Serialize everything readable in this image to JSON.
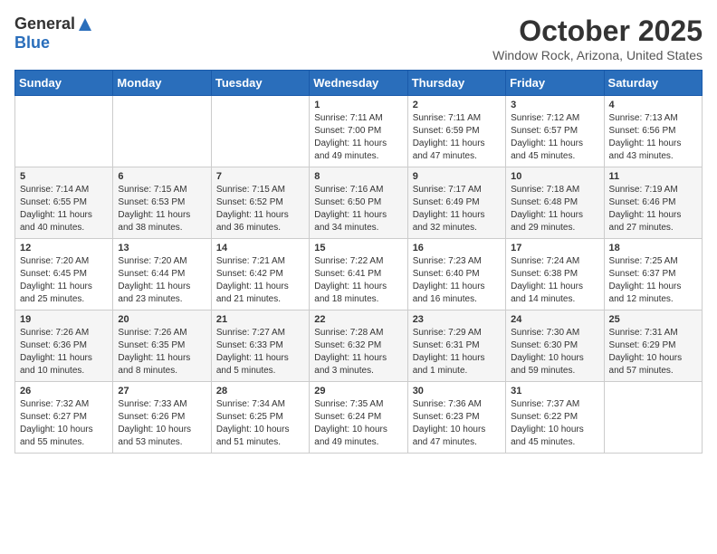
{
  "header": {
    "logo_general": "General",
    "logo_blue": "Blue",
    "month": "October 2025",
    "location": "Window Rock, Arizona, United States"
  },
  "days_of_week": [
    "Sunday",
    "Monday",
    "Tuesday",
    "Wednesday",
    "Thursday",
    "Friday",
    "Saturday"
  ],
  "weeks": [
    [
      {
        "day": "",
        "info": ""
      },
      {
        "day": "",
        "info": ""
      },
      {
        "day": "",
        "info": ""
      },
      {
        "day": "1",
        "info": "Sunrise: 7:11 AM\nSunset: 7:00 PM\nDaylight: 11 hours and 49 minutes."
      },
      {
        "day": "2",
        "info": "Sunrise: 7:11 AM\nSunset: 6:59 PM\nDaylight: 11 hours and 47 minutes."
      },
      {
        "day": "3",
        "info": "Sunrise: 7:12 AM\nSunset: 6:57 PM\nDaylight: 11 hours and 45 minutes."
      },
      {
        "day": "4",
        "info": "Sunrise: 7:13 AM\nSunset: 6:56 PM\nDaylight: 11 hours and 43 minutes."
      }
    ],
    [
      {
        "day": "5",
        "info": "Sunrise: 7:14 AM\nSunset: 6:55 PM\nDaylight: 11 hours and 40 minutes."
      },
      {
        "day": "6",
        "info": "Sunrise: 7:15 AM\nSunset: 6:53 PM\nDaylight: 11 hours and 38 minutes."
      },
      {
        "day": "7",
        "info": "Sunrise: 7:15 AM\nSunset: 6:52 PM\nDaylight: 11 hours and 36 minutes."
      },
      {
        "day": "8",
        "info": "Sunrise: 7:16 AM\nSunset: 6:50 PM\nDaylight: 11 hours and 34 minutes."
      },
      {
        "day": "9",
        "info": "Sunrise: 7:17 AM\nSunset: 6:49 PM\nDaylight: 11 hours and 32 minutes."
      },
      {
        "day": "10",
        "info": "Sunrise: 7:18 AM\nSunset: 6:48 PM\nDaylight: 11 hours and 29 minutes."
      },
      {
        "day": "11",
        "info": "Sunrise: 7:19 AM\nSunset: 6:46 PM\nDaylight: 11 hours and 27 minutes."
      }
    ],
    [
      {
        "day": "12",
        "info": "Sunrise: 7:20 AM\nSunset: 6:45 PM\nDaylight: 11 hours and 25 minutes."
      },
      {
        "day": "13",
        "info": "Sunrise: 7:20 AM\nSunset: 6:44 PM\nDaylight: 11 hours and 23 minutes."
      },
      {
        "day": "14",
        "info": "Sunrise: 7:21 AM\nSunset: 6:42 PM\nDaylight: 11 hours and 21 minutes."
      },
      {
        "day": "15",
        "info": "Sunrise: 7:22 AM\nSunset: 6:41 PM\nDaylight: 11 hours and 18 minutes."
      },
      {
        "day": "16",
        "info": "Sunrise: 7:23 AM\nSunset: 6:40 PM\nDaylight: 11 hours and 16 minutes."
      },
      {
        "day": "17",
        "info": "Sunrise: 7:24 AM\nSunset: 6:38 PM\nDaylight: 11 hours and 14 minutes."
      },
      {
        "day": "18",
        "info": "Sunrise: 7:25 AM\nSunset: 6:37 PM\nDaylight: 11 hours and 12 minutes."
      }
    ],
    [
      {
        "day": "19",
        "info": "Sunrise: 7:26 AM\nSunset: 6:36 PM\nDaylight: 11 hours and 10 minutes."
      },
      {
        "day": "20",
        "info": "Sunrise: 7:26 AM\nSunset: 6:35 PM\nDaylight: 11 hours and 8 minutes."
      },
      {
        "day": "21",
        "info": "Sunrise: 7:27 AM\nSunset: 6:33 PM\nDaylight: 11 hours and 5 minutes."
      },
      {
        "day": "22",
        "info": "Sunrise: 7:28 AM\nSunset: 6:32 PM\nDaylight: 11 hours and 3 minutes."
      },
      {
        "day": "23",
        "info": "Sunrise: 7:29 AM\nSunset: 6:31 PM\nDaylight: 11 hours and 1 minute."
      },
      {
        "day": "24",
        "info": "Sunrise: 7:30 AM\nSunset: 6:30 PM\nDaylight: 10 hours and 59 minutes."
      },
      {
        "day": "25",
        "info": "Sunrise: 7:31 AM\nSunset: 6:29 PM\nDaylight: 10 hours and 57 minutes."
      }
    ],
    [
      {
        "day": "26",
        "info": "Sunrise: 7:32 AM\nSunset: 6:27 PM\nDaylight: 10 hours and 55 minutes."
      },
      {
        "day": "27",
        "info": "Sunrise: 7:33 AM\nSunset: 6:26 PM\nDaylight: 10 hours and 53 minutes."
      },
      {
        "day": "28",
        "info": "Sunrise: 7:34 AM\nSunset: 6:25 PM\nDaylight: 10 hours and 51 minutes."
      },
      {
        "day": "29",
        "info": "Sunrise: 7:35 AM\nSunset: 6:24 PM\nDaylight: 10 hours and 49 minutes."
      },
      {
        "day": "30",
        "info": "Sunrise: 7:36 AM\nSunset: 6:23 PM\nDaylight: 10 hours and 47 minutes."
      },
      {
        "day": "31",
        "info": "Sunrise: 7:37 AM\nSunset: 6:22 PM\nDaylight: 10 hours and 45 minutes."
      },
      {
        "day": "",
        "info": ""
      }
    ]
  ]
}
